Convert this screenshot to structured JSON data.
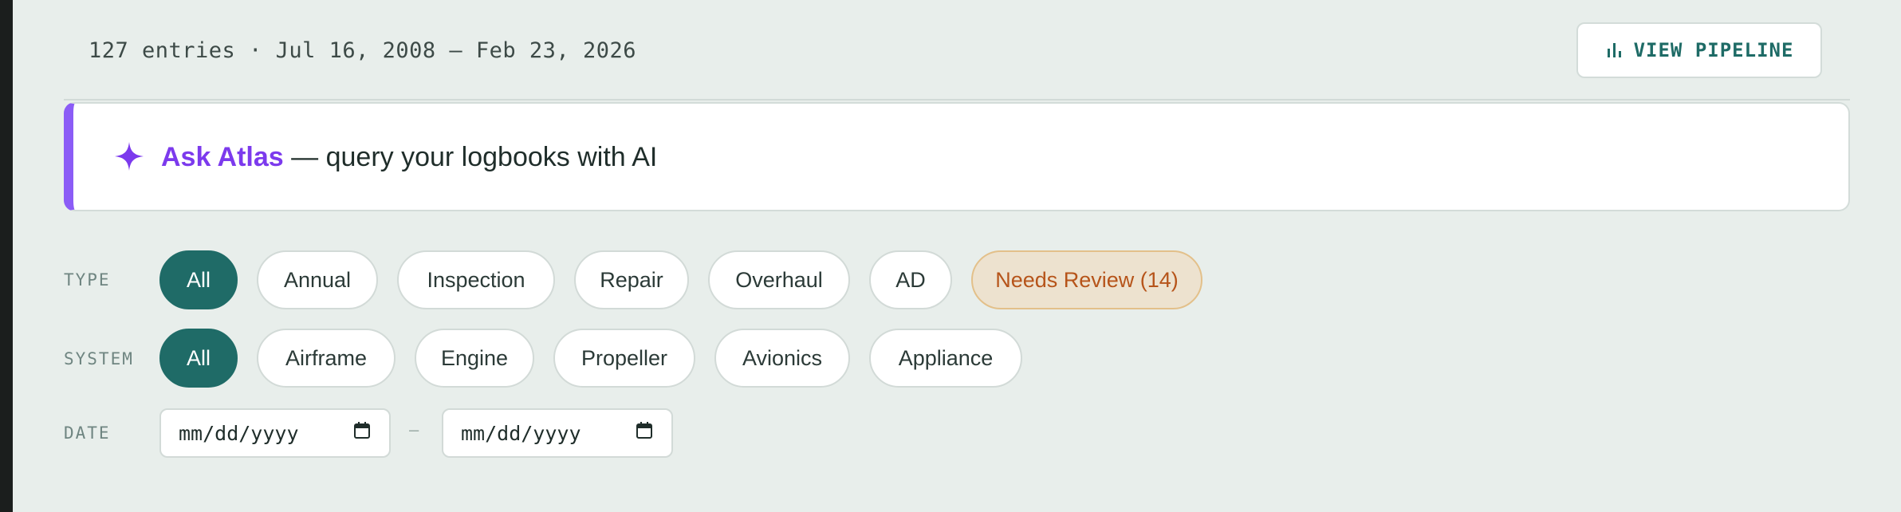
{
  "summary": {
    "entries_text": "127 entries · Jul 16, 2008 – Feb 23, 2026"
  },
  "toolbar": {
    "view_pipeline_label": "VIEW PIPELINE",
    "view_pipeline_icon": "bar-chart-icon"
  },
  "ask_atlas": {
    "icon": "sparkle-icon",
    "brand": "Ask Atlas",
    "tagline": " — query your logbooks with AI",
    "accent_color": "#8b5cf6"
  },
  "filters": {
    "type": {
      "label": "TYPE",
      "chips": [
        {
          "label": "All",
          "selected": true
        },
        {
          "label": "Annual",
          "selected": false
        },
        {
          "label": "Inspection",
          "selected": false
        },
        {
          "label": "Repair",
          "selected": false
        },
        {
          "label": "Overhaul",
          "selected": false
        },
        {
          "label": "AD",
          "selected": false
        },
        {
          "label": "Needs Review (14)",
          "selected": false,
          "variant": "warning"
        }
      ]
    },
    "system": {
      "label": "SYSTEM",
      "chips": [
        {
          "label": "All",
          "selected": true
        },
        {
          "label": "Airframe",
          "selected": false
        },
        {
          "label": "Engine",
          "selected": false
        },
        {
          "label": "Propeller",
          "selected": false
        },
        {
          "label": "Avionics",
          "selected": false
        },
        {
          "label": "Appliance",
          "selected": false
        }
      ]
    },
    "date": {
      "label": "DATE",
      "from_placeholder": "mm/dd/yyyy",
      "to_placeholder": "mm/dd/yyyy",
      "separator": "–",
      "input_icon": "calendar-icon"
    }
  },
  "colors": {
    "background": "#e8eeeb",
    "primary": "#1f6b67",
    "warning_bg": "#ede2cf",
    "warning_text": "#b6541a",
    "brand_purple": "#7c3aed"
  }
}
